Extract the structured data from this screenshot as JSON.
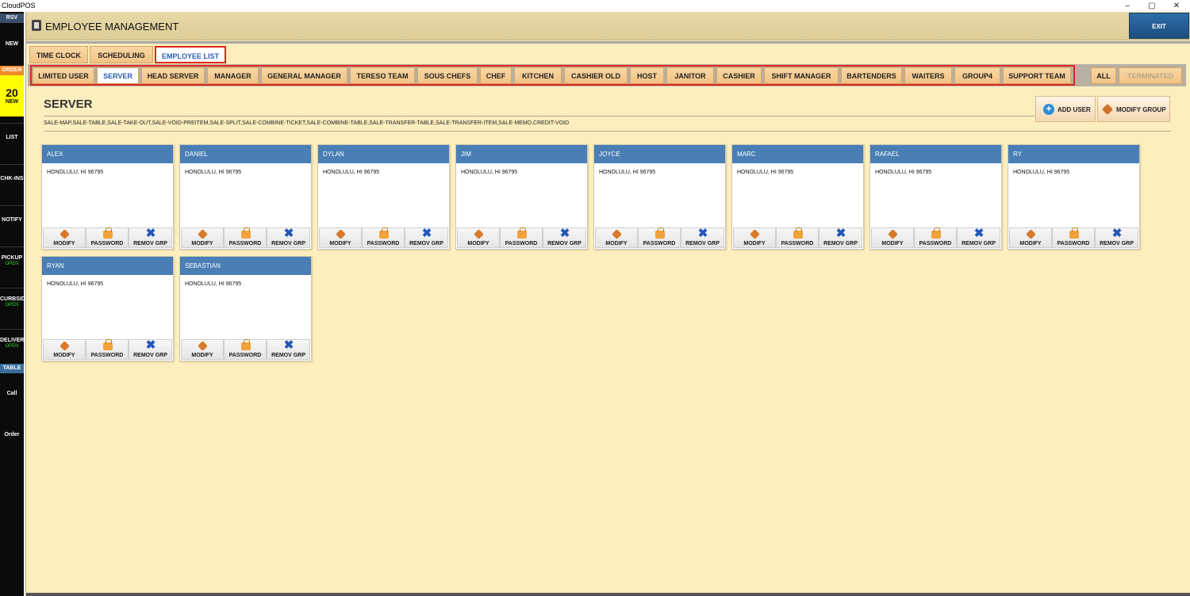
{
  "window": {
    "title": "CloudPOS",
    "minimize": "–",
    "maximize": "▢",
    "close": "✕"
  },
  "sidebar": {
    "rsv": "RSV",
    "new_label": "NEW",
    "order": "ORDER",
    "order_count": "20",
    "order_new": "NEW",
    "list": "LIST",
    "chk_ins": "CHK-INS",
    "notify": "NOTIFY",
    "pickup": "PICKUP",
    "pickup_status": "OPEN",
    "curbside": "CURBSID",
    "curbside_status": "OPEN",
    "delivery": "DELIVER",
    "delivery_status": "OPEN",
    "table": "TABLE",
    "call": "Call",
    "order2": "Order"
  },
  "header": {
    "title": "EMPLOYEE MANAGEMENT",
    "exit": "EXIT"
  },
  "top_tabs": [
    "TIME CLOCK",
    "SCHEDULING",
    "EMPLOYEE LIST"
  ],
  "group_tabs": [
    "LIMITED USER",
    "SERVER",
    "HEAD SERVER",
    "MANAGER",
    "GENERAL MANAGER",
    "TERESO TEAM",
    "SOUS CHEFS",
    "CHEF",
    "KITCHEN",
    "CASHIER OLD",
    "HOST",
    "JANITOR",
    "CASHIER",
    "SHIFT MANAGER",
    "BARTENDERS",
    "WAITERS",
    "GROUP4",
    "SUPPORT TEAM"
  ],
  "filter_tabs": [
    "ALL",
    "TERMINATED"
  ],
  "section": {
    "title": "SERVER",
    "permissions": "SALE-MAP,SALE-TABLE,SALE-TAKE-OUT,SALE-VOID-PREITEM,SALE-SPLIT,SALE-COMBINE-TICKET,SALE-COMBINE-TABLE,SALE-TRANSFER-TABLE,SALE-TRANSFER-ITEM,SALE-MEMO,CREDIT-VOID",
    "add_user": "ADD USER",
    "modify_group": "MODIFY GROUP"
  },
  "card_actions": {
    "modify": "MODIFY",
    "password": "PASSWORD",
    "remove": "REMOV GRP"
  },
  "employees": [
    {
      "name": "ALEX",
      "address": "HONOLULU, HI 96795"
    },
    {
      "name": "DANIEL",
      "address": "HONOLULU, HI 96795"
    },
    {
      "name": "DYLAN",
      "address": "HONOLULU, HI 96795"
    },
    {
      "name": "JIM",
      "address": "HONOLULU, HI 96795"
    },
    {
      "name": "JOYCE",
      "address": "HONOLULU, HI 96795"
    },
    {
      "name": "MARC",
      "address": "HONOLULU, HI 96795"
    },
    {
      "name": "RAFAEL",
      "address": "HONOLULU, HI 96795"
    },
    {
      "name": "RY",
      "address": "HONOLULU, HI 96795"
    },
    {
      "name": "RYAN",
      "address": "HONOLULU, HI 96795"
    },
    {
      "name": "SEBASTIAN",
      "address": "HONOLULU, HI 96795"
    }
  ],
  "colors": {
    "accent": "#e0261c",
    "card_header": "#4a7eb5",
    "background": "#fdeebe",
    "exit_button": "#2d6ea8"
  }
}
